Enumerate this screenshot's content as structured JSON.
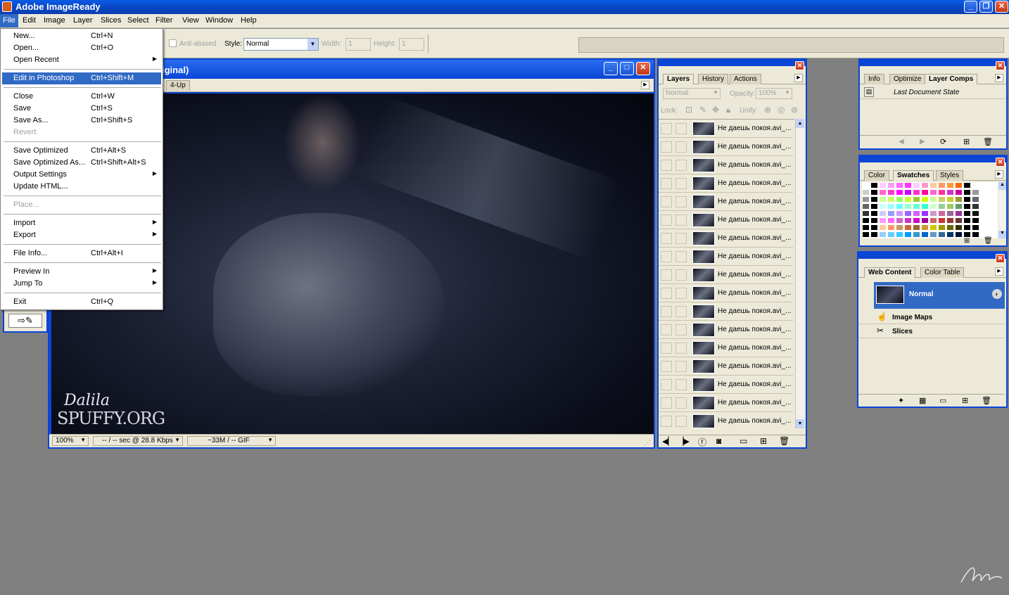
{
  "app": {
    "title": "Adobe ImageReady"
  },
  "menubar": [
    "File",
    "Edit",
    "Image",
    "Layer",
    "Slices",
    "Select",
    "Filter",
    "View",
    "Window",
    "Help"
  ],
  "options": {
    "anti_aliased": "Anti-aliased",
    "style_label": "Style:",
    "style_value": "Normal",
    "width_label": "Width:",
    "width_value": "1",
    "height_label": "Height:",
    "height_value": "1"
  },
  "file_menu": {
    "items": [
      {
        "label": "New...",
        "shortcut": "Ctrl+N"
      },
      {
        "label": "Open...",
        "shortcut": "Ctrl+O"
      },
      {
        "label": "Open Recent",
        "shortcut": ""
      },
      {
        "label": "Edit in Photoshop",
        "shortcut": "Ctrl+Shift+M"
      },
      {
        "label": "Close",
        "shortcut": "Ctrl+W"
      },
      {
        "label": "Save",
        "shortcut": "Ctrl+S"
      },
      {
        "label": "Save As...",
        "shortcut": "Ctrl+Shift+S"
      },
      {
        "label": "Revert",
        "shortcut": ""
      },
      {
        "label": "Save Optimized",
        "shortcut": "Ctrl+Alt+S"
      },
      {
        "label": "Save Optimized As...",
        "shortcut": "Ctrl+Shift+Alt+S"
      },
      {
        "label": "Output Settings",
        "shortcut": ""
      },
      {
        "label": "Update HTML...",
        "shortcut": ""
      },
      {
        "label": "Place...",
        "shortcut": ""
      },
      {
        "label": "Import",
        "shortcut": ""
      },
      {
        "label": "Export",
        "shortcut": ""
      },
      {
        "label": "File Info...",
        "shortcut": "Ctrl+Alt+I"
      },
      {
        "label": "Preview In",
        "shortcut": ""
      },
      {
        "label": "Jump To",
        "shortcut": ""
      },
      {
        "label": "Exit",
        "shortcut": "Ctrl+Q"
      }
    ]
  },
  "document": {
    "title_fragment": "iginal)",
    "tab_4up": "4-Up",
    "watermark_line1": "Dalila",
    "watermark_line2": "SPUFFY.ORG",
    "zoom": "100%",
    "speed": "-- / -- sec @ 28.8 Kbps",
    "size": "~33M / -- GIF"
  },
  "layers_panel": {
    "tabs": [
      "Layers",
      "History",
      "Actions"
    ],
    "blend_mode": "Normal",
    "opacity_label": "Opacity:",
    "opacity_value": "100%",
    "lock_label": "Lock:",
    "unify_label": "Unify:",
    "layer_name": "Не даешь покоя.avi_..."
  },
  "layercomps_panel": {
    "tabs": [
      "Info",
      "Optimize",
      "Layer Comps"
    ],
    "state": "Last Document State"
  },
  "swatches_panel": {
    "tabs": [
      "Color",
      "Swatches",
      "Styles"
    ]
  },
  "webcontent_panel": {
    "tabs": [
      "Web Content",
      "Color Table"
    ],
    "normal": "Normal",
    "image_maps": "Image Maps",
    "slices": "Slices"
  },
  "colors": {
    "xp_blue": "#0a45d6",
    "menu_highlight": "#316ac5",
    "face": "#ece9d8",
    "desktop": "#808080"
  }
}
